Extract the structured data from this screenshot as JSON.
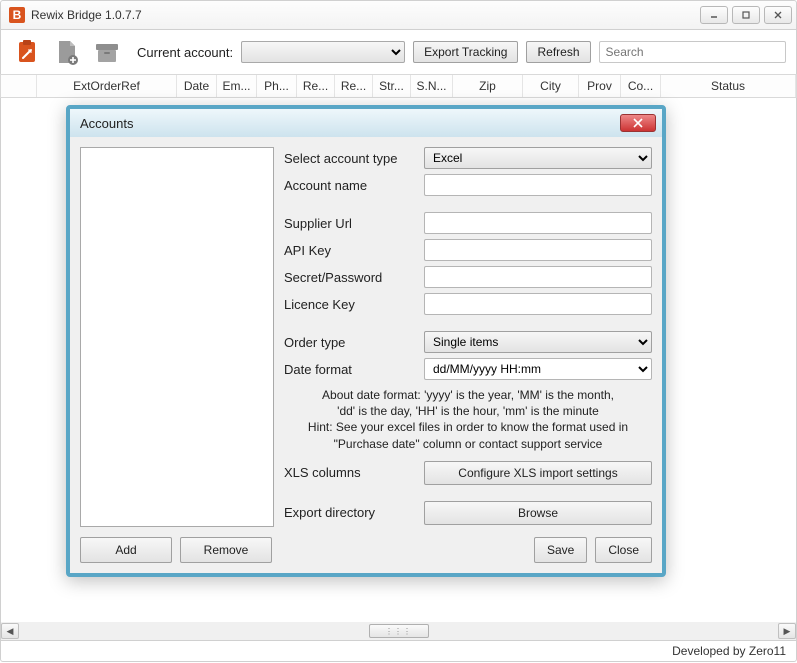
{
  "titlebar": {
    "icon_text": "B",
    "title": "Rewix Bridge 1.0.7.7"
  },
  "toolbar": {
    "current_account_label": "Current account:",
    "export_tracking": "Export Tracking",
    "refresh": "Refresh",
    "search_placeholder": "Search"
  },
  "columns": [
    "",
    "ExtOrderRef",
    "Date",
    "Em...",
    "Ph...",
    "Re...",
    "Re...",
    "Str...",
    "S.N...",
    "Zip",
    "City",
    "Prov",
    "Co...",
    "Status"
  ],
  "footer": {
    "text": "Developed by Zero11"
  },
  "dialog": {
    "title": "Accounts",
    "labels": {
      "select_account_type": "Select account type",
      "account_name": "Account name",
      "supplier_url": "Supplier Url",
      "api_key": "API Key",
      "secret_password": "Secret/Password",
      "licence_key": "Licence Key",
      "order_type": "Order type",
      "date_format": "Date format",
      "xls_columns": "XLS columns",
      "export_directory": "Export directory"
    },
    "values": {
      "account_type": "Excel",
      "order_type": "Single items",
      "date_format": "dd/MM/yyyy HH:mm"
    },
    "hint_line1": "About date format: 'yyyy' is the year, 'MM' is the month,",
    "hint_line2": "'dd' is the day, 'HH' is the hour, 'mm' is the minute",
    "hint_line3": "Hint: See your excel files in order to know the format used in",
    "hint_line4": "\"Purchase date\" column or contact support service",
    "buttons": {
      "configure_xls": "Configure XLS import settings",
      "browse": "Browse",
      "add": "Add",
      "remove": "Remove",
      "save": "Save",
      "close": "Close"
    }
  }
}
